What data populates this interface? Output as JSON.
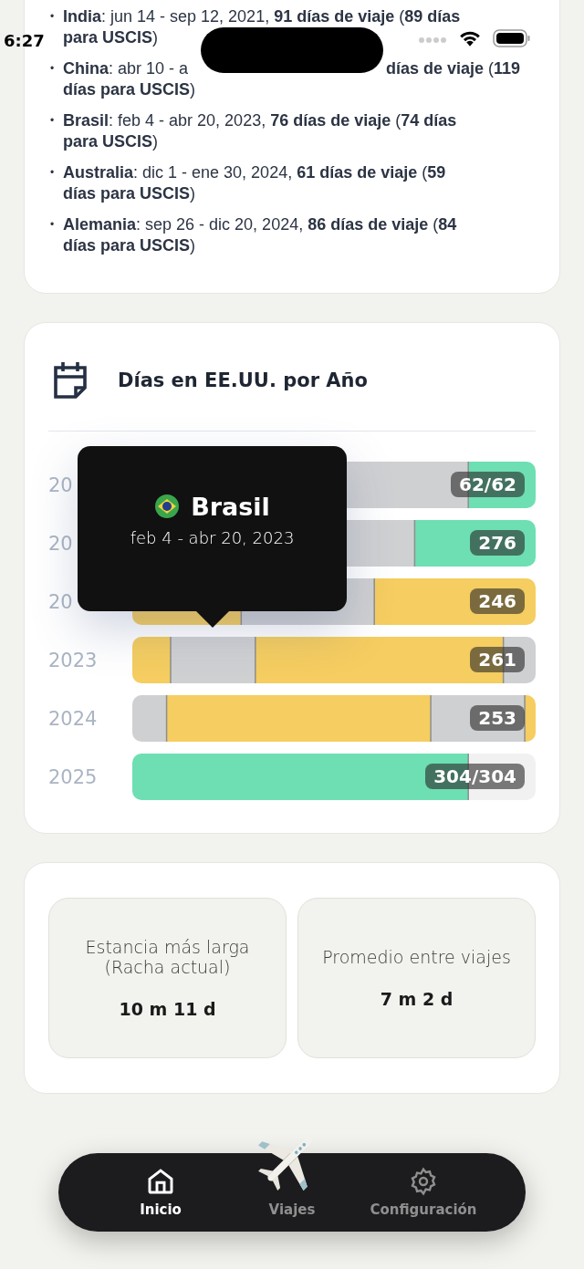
{
  "status_bar": {
    "time": "6:27"
  },
  "trips": [
    {
      "marker": "•",
      "lines": [
        [
          "**India**: jun 14 - sep 12, 2021, **91 días de viaje** (**89 días**"
        ],
        [
          "**para USCIS**)"
        ]
      ]
    },
    {
      "marker": "•",
      "lines": [
        [
          "**China**: abr 10 - a",
          "**días de viaje** (**119**"
        ],
        [
          "**días para USCIS**)"
        ]
      ]
    },
    {
      "marker": "•",
      "lines": [
        [
          "**Brasil**: feb 4 - abr 20, 2023, **76 días de viaje** (**74 días**"
        ],
        [
          "**para USCIS**)"
        ]
      ]
    },
    {
      "marker": "•",
      "lines": [
        [
          "**Australia**: dic 1 - ene 30, 2024, **61 días de viaje** (**59**"
        ],
        [
          "**días para USCIS**)"
        ]
      ]
    },
    {
      "marker": "•",
      "lines": [
        [
          "**Alemania**: sep 26 - dic 20, 2024, **86 días de viaje** (**84**"
        ],
        [
          "**días para USCIS**)"
        ]
      ]
    }
  ],
  "days_card": {
    "title": "Días en EE.UU. por Año",
    "rows": [
      {
        "year": "20",
        "value": "62/62"
      },
      {
        "year": "20",
        "value": "276"
      },
      {
        "year": "20",
        "value": "246"
      },
      {
        "year": "2023",
        "value": "261"
      },
      {
        "year": "2024",
        "value": "253"
      },
      {
        "year": "2025",
        "value": "304/304"
      }
    ],
    "tooltip": {
      "country": "Brasil",
      "dates": "feb 4 - abr 20, 2023"
    }
  },
  "stats": [
    {
      "label": "Estancia más larga (Racha actual)",
      "value": "10 m 11 d"
    },
    {
      "label": "Promedio entre viajes",
      "value": "7 m 2 d"
    }
  ],
  "nav": [
    {
      "label": "Inicio",
      "selected": true
    },
    {
      "label": "Viajes",
      "selected": false
    },
    {
      "label": "Configuración",
      "selected": false
    }
  ]
}
